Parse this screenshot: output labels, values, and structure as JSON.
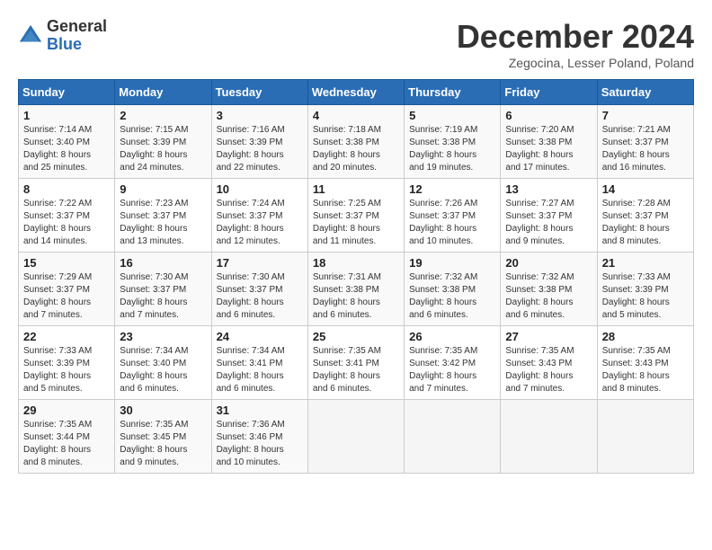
{
  "logo": {
    "general": "General",
    "blue": "Blue"
  },
  "header": {
    "title": "December 2024",
    "subtitle": "Zegocina, Lesser Poland, Poland"
  },
  "days_of_week": [
    "Sunday",
    "Monday",
    "Tuesday",
    "Wednesday",
    "Thursday",
    "Friday",
    "Saturday"
  ],
  "weeks": [
    [
      {
        "num": "1",
        "sunrise": "7:14 AM",
        "sunset": "3:40 PM",
        "daylight": "8 hours and 25 minutes."
      },
      {
        "num": "2",
        "sunrise": "7:15 AM",
        "sunset": "3:39 PM",
        "daylight": "8 hours and 24 minutes."
      },
      {
        "num": "3",
        "sunrise": "7:16 AM",
        "sunset": "3:39 PM",
        "daylight": "8 hours and 22 minutes."
      },
      {
        "num": "4",
        "sunrise": "7:18 AM",
        "sunset": "3:38 PM",
        "daylight": "8 hours and 20 minutes."
      },
      {
        "num": "5",
        "sunrise": "7:19 AM",
        "sunset": "3:38 PM",
        "daylight": "8 hours and 19 minutes."
      },
      {
        "num": "6",
        "sunrise": "7:20 AM",
        "sunset": "3:38 PM",
        "daylight": "8 hours and 17 minutes."
      },
      {
        "num": "7",
        "sunrise": "7:21 AM",
        "sunset": "3:37 PM",
        "daylight": "8 hours and 16 minutes."
      }
    ],
    [
      {
        "num": "8",
        "sunrise": "7:22 AM",
        "sunset": "3:37 PM",
        "daylight": "8 hours and 14 minutes."
      },
      {
        "num": "9",
        "sunrise": "7:23 AM",
        "sunset": "3:37 PM",
        "daylight": "8 hours and 13 minutes."
      },
      {
        "num": "10",
        "sunrise": "7:24 AM",
        "sunset": "3:37 PM",
        "daylight": "8 hours and 12 minutes."
      },
      {
        "num": "11",
        "sunrise": "7:25 AM",
        "sunset": "3:37 PM",
        "daylight": "8 hours and 11 minutes."
      },
      {
        "num": "12",
        "sunrise": "7:26 AM",
        "sunset": "3:37 PM",
        "daylight": "8 hours and 10 minutes."
      },
      {
        "num": "13",
        "sunrise": "7:27 AM",
        "sunset": "3:37 PM",
        "daylight": "8 hours and 9 minutes."
      },
      {
        "num": "14",
        "sunrise": "7:28 AM",
        "sunset": "3:37 PM",
        "daylight": "8 hours and 8 minutes."
      }
    ],
    [
      {
        "num": "15",
        "sunrise": "7:29 AM",
        "sunset": "3:37 PM",
        "daylight": "8 hours and 7 minutes."
      },
      {
        "num": "16",
        "sunrise": "7:30 AM",
        "sunset": "3:37 PM",
        "daylight": "8 hours and 7 minutes."
      },
      {
        "num": "17",
        "sunrise": "7:30 AM",
        "sunset": "3:37 PM",
        "daylight": "8 hours and 6 minutes."
      },
      {
        "num": "18",
        "sunrise": "7:31 AM",
        "sunset": "3:38 PM",
        "daylight": "8 hours and 6 minutes."
      },
      {
        "num": "19",
        "sunrise": "7:32 AM",
        "sunset": "3:38 PM",
        "daylight": "8 hours and 6 minutes."
      },
      {
        "num": "20",
        "sunrise": "7:32 AM",
        "sunset": "3:38 PM",
        "daylight": "8 hours and 6 minutes."
      },
      {
        "num": "21",
        "sunrise": "7:33 AM",
        "sunset": "3:39 PM",
        "daylight": "8 hours and 5 minutes."
      }
    ],
    [
      {
        "num": "22",
        "sunrise": "7:33 AM",
        "sunset": "3:39 PM",
        "daylight": "8 hours and 5 minutes."
      },
      {
        "num": "23",
        "sunrise": "7:34 AM",
        "sunset": "3:40 PM",
        "daylight": "8 hours and 6 minutes."
      },
      {
        "num": "24",
        "sunrise": "7:34 AM",
        "sunset": "3:41 PM",
        "daylight": "8 hours and 6 minutes."
      },
      {
        "num": "25",
        "sunrise": "7:35 AM",
        "sunset": "3:41 PM",
        "daylight": "8 hours and 6 minutes."
      },
      {
        "num": "26",
        "sunrise": "7:35 AM",
        "sunset": "3:42 PM",
        "daylight": "8 hours and 7 minutes."
      },
      {
        "num": "27",
        "sunrise": "7:35 AM",
        "sunset": "3:43 PM",
        "daylight": "8 hours and 7 minutes."
      },
      {
        "num": "28",
        "sunrise": "7:35 AM",
        "sunset": "3:43 PM",
        "daylight": "8 hours and 8 minutes."
      }
    ],
    [
      {
        "num": "29",
        "sunrise": "7:35 AM",
        "sunset": "3:44 PM",
        "daylight": "8 hours and 8 minutes."
      },
      {
        "num": "30",
        "sunrise": "7:35 AM",
        "sunset": "3:45 PM",
        "daylight": "8 hours and 9 minutes."
      },
      {
        "num": "31",
        "sunrise": "7:36 AM",
        "sunset": "3:46 PM",
        "daylight": "8 hours and 10 minutes."
      },
      null,
      null,
      null,
      null
    ]
  ]
}
